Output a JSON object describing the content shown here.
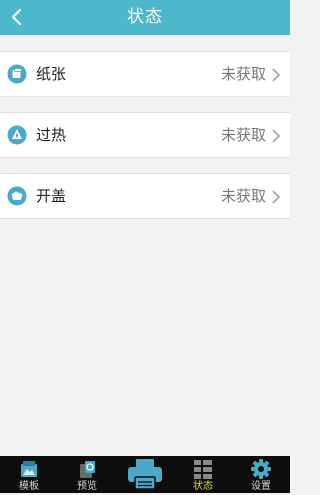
{
  "header": {
    "title": "状态",
    "back_icon": "chevron-left-icon"
  },
  "status_items": [
    {
      "icon": "paper-icon",
      "label": "纸张",
      "value": "未获取"
    },
    {
      "icon": "overheat-icon",
      "label": "过热",
      "value": "未获取"
    },
    {
      "icon": "cover-open-icon",
      "label": "开盖",
      "value": "未获取"
    }
  ],
  "tabbar": {
    "tabs": [
      {
        "icon": "template-icon",
        "label": "模板"
      },
      {
        "icon": "preview-icon",
        "label": "预览"
      },
      {
        "icon": "printer-icon",
        "label": ""
      },
      {
        "icon": "status-grid-icon",
        "label": "状态",
        "active": true
      },
      {
        "icon": "settings-gear-icon",
        "label": "设置"
      }
    ]
  },
  "colors": {
    "header_bg": "#4db8cc",
    "icon_accent": "#4aa9c6",
    "active_tab_label": "#e0d64a",
    "tabbar_bg": "#0d0d0d"
  }
}
